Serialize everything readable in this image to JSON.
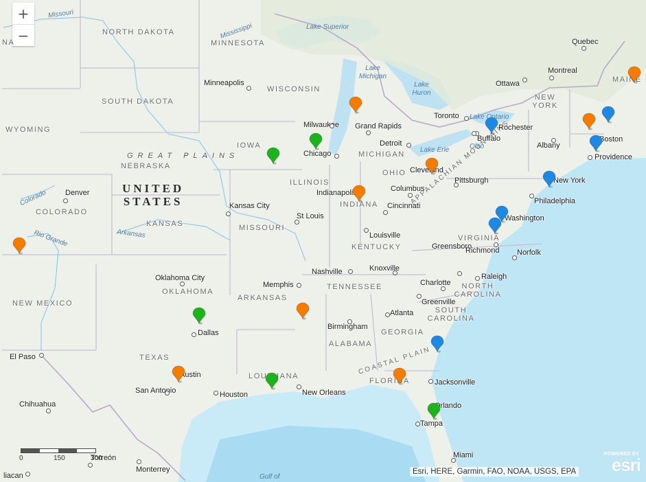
{
  "map": {
    "zoom_in_label": "+",
    "zoom_out_label": "−",
    "attribution": "Esri, HERE, Garmin, FAO, NOAA, USGS, EPA",
    "esri_logo": {
      "powered_by": "POWERED BY",
      "brand": "esri"
    },
    "scale": {
      "ticks": [
        "0",
        "150",
        "300"
      ],
      "units": "mi"
    },
    "country_label": [
      "UNITED",
      "STATES"
    ],
    "region_labels": [
      "GREAT PLAINS",
      "COASTAL PLAIN",
      "APPALACHIAN MOUNTAINS"
    ],
    "states": [
      "NORTH DAKOTA",
      "SOUTH DAKOTA",
      "WYOMING",
      "NEBRASKA",
      "COLORADO",
      "KANSAS",
      "MINNESOTA",
      "WISCONSIN",
      "IOWA",
      "ILLINOIS",
      "MISSOURI",
      "OKLAHOMA",
      "NEW MEXICO",
      "TEXAS",
      "ARKANSAS",
      "LOUISIANA",
      "MICHIGAN",
      "INDIANA",
      "OHIO",
      "KENTUCKY",
      "TENNESSEE",
      "ALABAMA",
      "GEORGIA",
      "FLORIDA",
      "SOUTH CAROLINA",
      "NORTH CAROLINA",
      "VIRGINIA",
      "NEW YORK",
      "MAINE",
      "NA"
    ],
    "waters": [
      "Missouri",
      "Mississippi",
      "Lake Superior",
      "Lake Michigan",
      "Lake Huron",
      "Lake Ontario",
      "Lake Erie",
      "Ohio",
      "Colorado",
      "Rio Grande",
      "Arkansas",
      "Gulf of"
    ],
    "cities": [
      "Minneapolis",
      "Milwaukee",
      "Chicago",
      "Grand Rapids",
      "Detroit",
      "Toronto",
      "Ottawa",
      "Montreal",
      "Quebec",
      "Rochester",
      "Buffalo",
      "Albany",
      "Boston",
      "Providence",
      "New York",
      "Philadelphia",
      "Pittsburgh",
      "Cleveland",
      "Columbus",
      "Cincinnati",
      "Indianapolis",
      "Louisville",
      "St Louis",
      "Kansas City",
      "Denver",
      "Oklahoma City",
      "Dallas",
      "Austin",
      "San Antonio",
      "Houston",
      "El Paso",
      "Chihuahua",
      "Torreon",
      "Monterrey",
      "Culiacan",
      "New Orleans",
      "Memphis",
      "Nashville",
      "Knoxville",
      "Birmingham",
      "Atlanta",
      "Greenville",
      "Charlotte",
      "Greensboro",
      "Raleigh",
      "Richmond",
      "Norfolk",
      "Washington",
      "Jacksonville",
      "Orlando",
      "Tampa",
      "Miami"
    ],
    "marker_colors": {
      "orange": "#f57c00",
      "green": "#1db31d",
      "blue": "#1e88e5"
    },
    "markers": [
      {
        "color": "orange",
        "near": "Maine"
      },
      {
        "color": "orange",
        "near": "New Hampshire"
      },
      {
        "color": "blue",
        "near": "Maine coast"
      },
      {
        "color": "blue",
        "near": "Boston"
      },
      {
        "color": "blue",
        "near": "Rochester"
      },
      {
        "color": "blue",
        "near": "New York"
      },
      {
        "color": "blue",
        "near": "Washington"
      },
      {
        "color": "blue",
        "near": "Virginia"
      },
      {
        "color": "blue",
        "near": "South Carolina coast"
      },
      {
        "color": "orange",
        "near": "Michigan"
      },
      {
        "color": "orange",
        "near": "Cleveland"
      },
      {
        "color": "orange",
        "near": "Indianapolis"
      },
      {
        "color": "green",
        "near": "Chicago"
      },
      {
        "color": "green",
        "near": "Iowa"
      },
      {
        "color": "orange",
        "near": "Colorado"
      },
      {
        "color": "green",
        "near": "Dallas"
      },
      {
        "color": "orange",
        "near": "Austin"
      },
      {
        "color": "green",
        "near": "Louisiana"
      },
      {
        "color": "orange",
        "near": "Mississippi"
      },
      {
        "color": "orange",
        "near": "Florida"
      },
      {
        "color": "green",
        "near": "Orlando"
      }
    ]
  }
}
